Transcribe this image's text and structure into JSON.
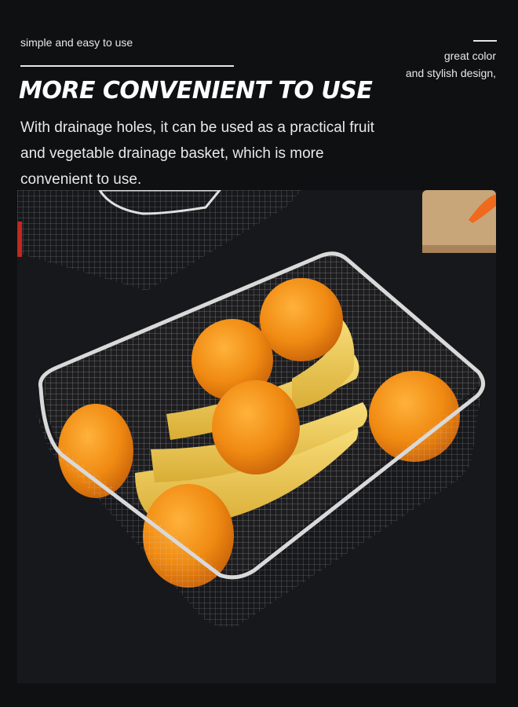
{
  "header": {
    "tagline": "simple and easy to use",
    "side_note_line1": "great color",
    "side_note_line2": "and stylish design,"
  },
  "main": {
    "headline": "MORE CONVENIENT TO USE",
    "description": "With drainage holes, it can be used as a practical fruit and vegetable drainage basket, which is more convenient to use."
  },
  "photo": {
    "subject": "stainless steel mesh basket with oranges and bananas",
    "colors": {
      "orange": "#f08a12",
      "banana": "#f2cf5a",
      "steel": "#c9c9c9",
      "background": "#17181b"
    }
  }
}
